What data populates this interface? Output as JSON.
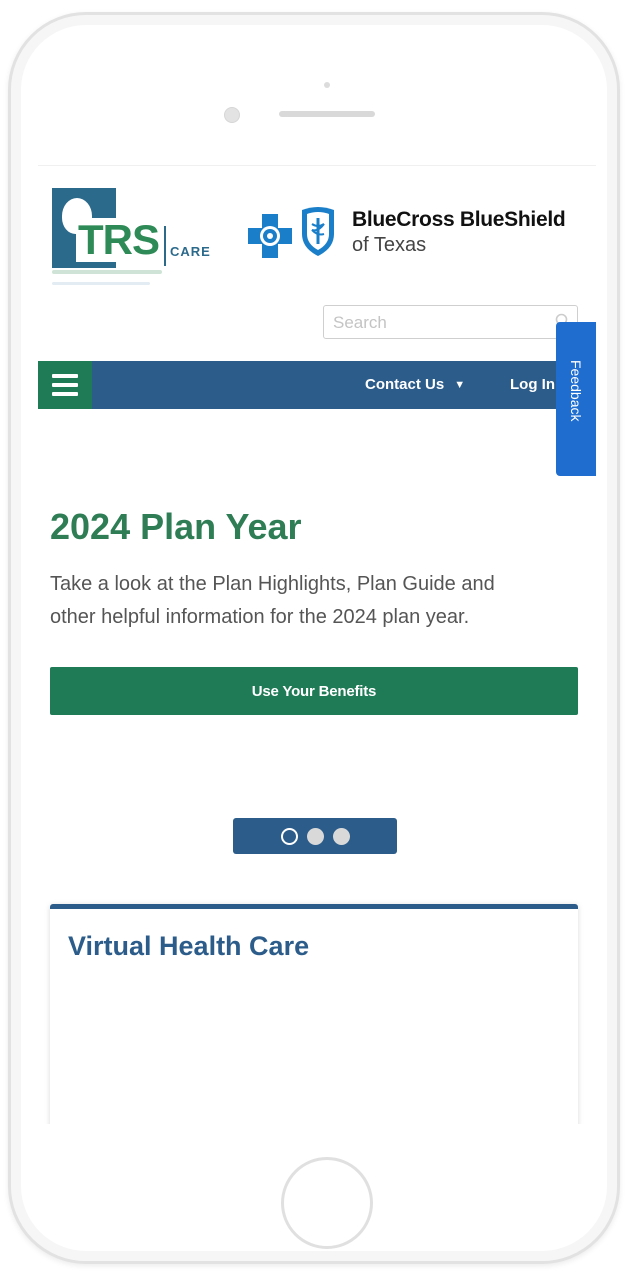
{
  "header": {
    "trs_logo_text": "TRS",
    "trs_logo_subtext": "CARE",
    "bcbs_name": "BlueCross BlueShield",
    "bcbs_state": "of Texas"
  },
  "search": {
    "placeholder": "Search",
    "value": ""
  },
  "nav": {
    "contact_label": "Contact Us",
    "contact_caret": "▼",
    "login_label": "Log In"
  },
  "feedback": {
    "label": "Feedback"
  },
  "hero": {
    "title": "2024 Plan Year",
    "text": "Take a look at the Plan Highlights, Plan Guide and other helpful information for the 2024 plan year.",
    "button_label": "Use Your Benefits"
  },
  "carousel": {
    "total_slides": 3,
    "active_index": 0
  },
  "card": {
    "title": "Virtual Health Care"
  },
  "colors": {
    "nav_blue": "#2b5c8a",
    "brand_green": "#1f7a56",
    "title_green": "#2e7d55",
    "feedback_blue": "#1f6dcf"
  }
}
